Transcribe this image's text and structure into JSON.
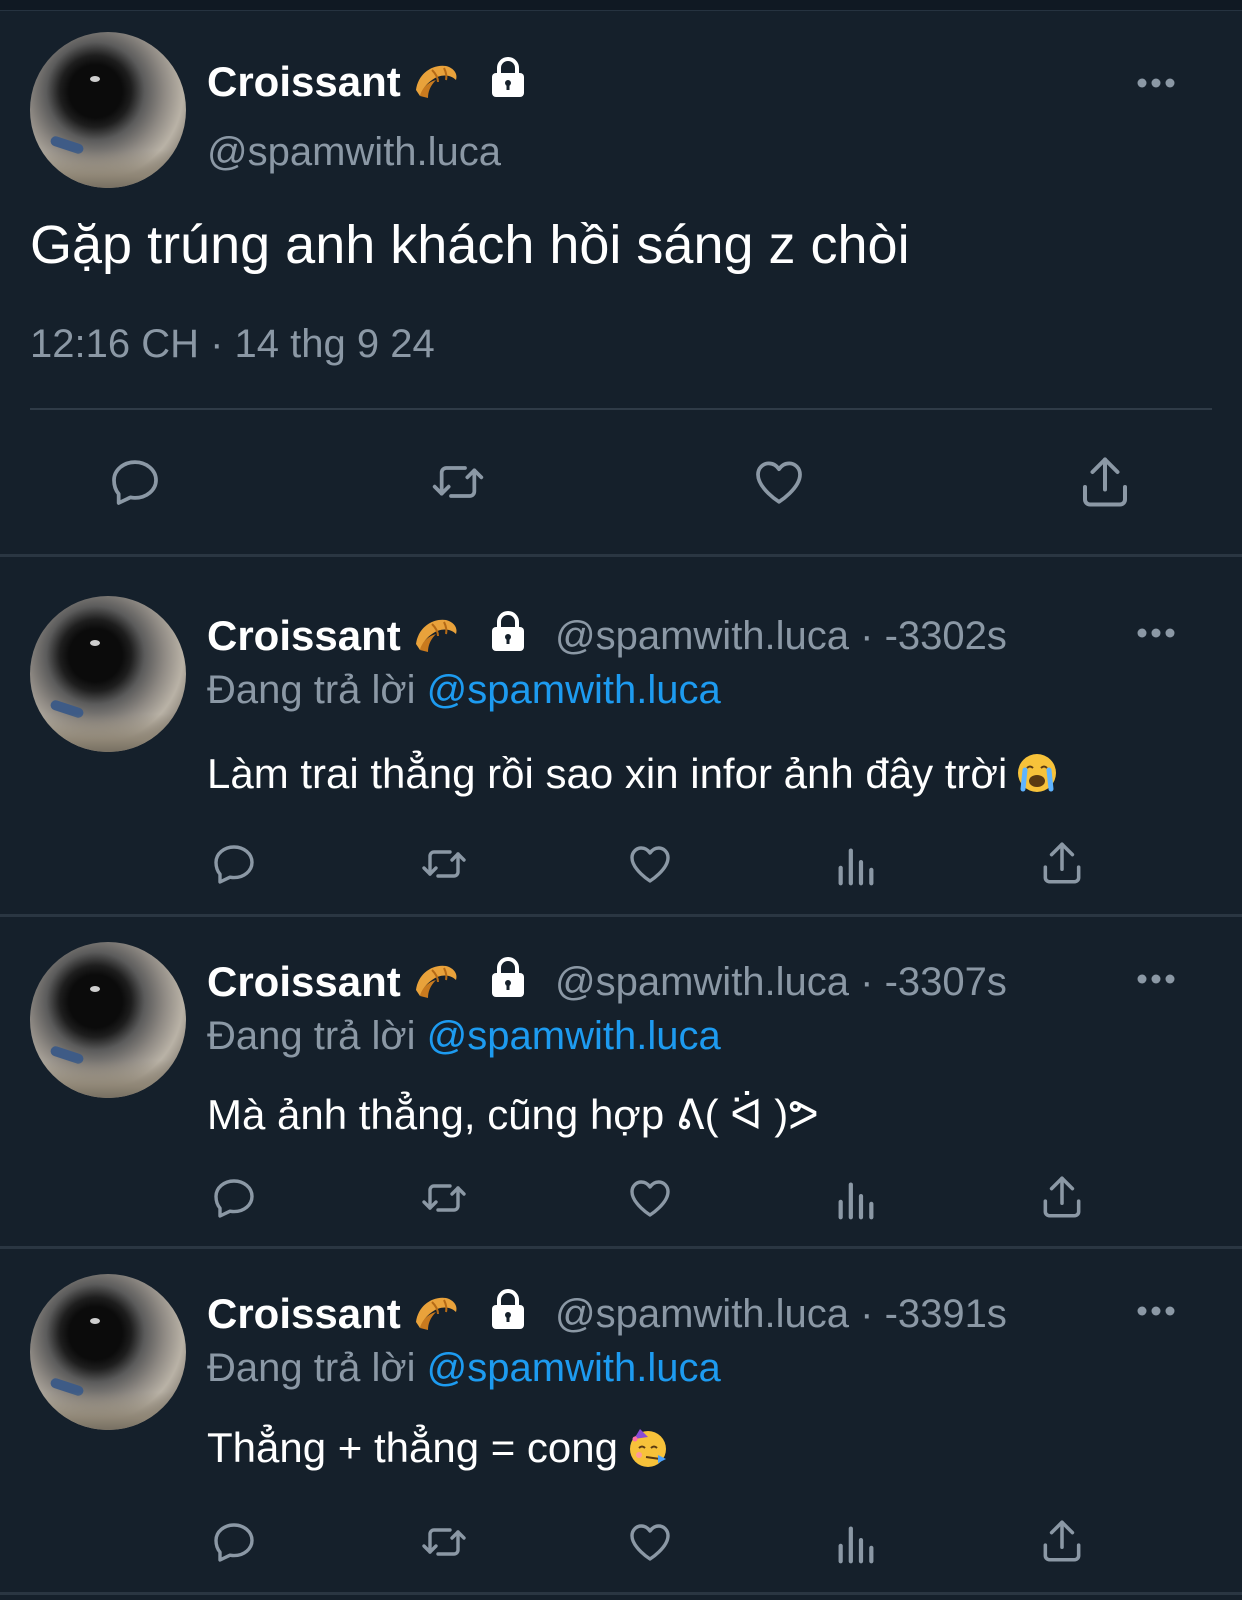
{
  "main_tweet": {
    "name": "Croissant",
    "handle": "@spamwith.luca",
    "text": "Gặp trúng anh khách hồi sáng z chòi",
    "timestamp": "12:16 CH · 14 thg 9 24"
  },
  "replies": [
    {
      "name": "Croissant",
      "handle_time": "@spamwith.luca · -3302s",
      "replying_prefix": "Đang trả lời",
      "replying_to": "@spamwith.luca",
      "text": "Làm trai thẳng rồi sao xin infor ảnh đây trời",
      "emoji": "crying-face"
    },
    {
      "name": "Croissant",
      "handle_time": "@spamwith.luca · -3307s",
      "replying_prefix": "Đang trả lời",
      "replying_to": "@spamwith.luca",
      "text": "Mà ảnh thẳng, cũng hợp ᕕ( ᐛ )ᕗ",
      "emoji": ""
    },
    {
      "name": "Croissant",
      "handle_time": "@spamwith.luca · -3391s",
      "replying_prefix": "Đang trả lời",
      "replying_to": "@spamwith.luca",
      "text": "Thẳng + thẳng = cong",
      "emoji": "partying-face"
    }
  ],
  "icons": {
    "name_emoji": "croissant-icon",
    "protected": "lock-icon",
    "more": "more-options-icon",
    "actions_main": [
      "reply-icon",
      "retweet-icon",
      "like-icon",
      "share-icon"
    ],
    "actions_reply": [
      "reply-icon",
      "retweet-icon",
      "like-icon",
      "views-icon",
      "share-icon"
    ]
  },
  "colors": {
    "background": "#15202b",
    "text_primary": "#ffffff",
    "text_secondary": "#8b98a5",
    "link": "#1d9bf0",
    "divider": "#2f3b47"
  }
}
